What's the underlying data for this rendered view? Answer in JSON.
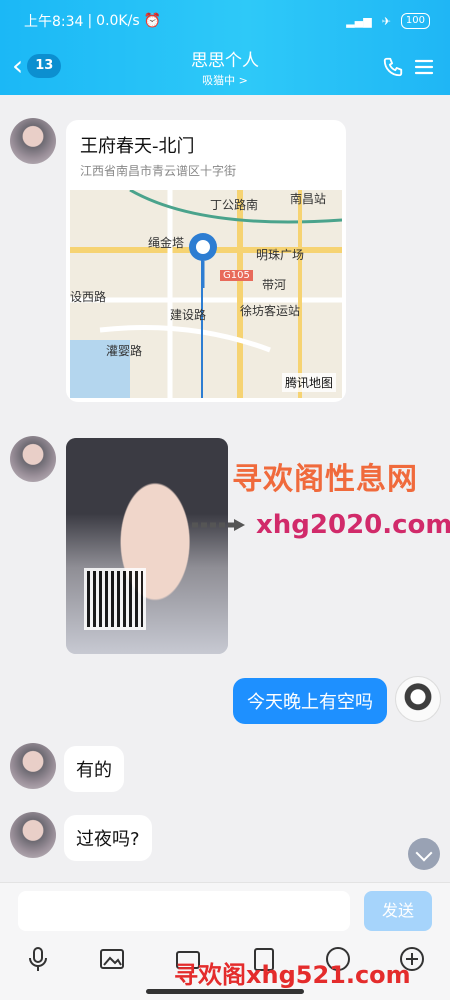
{
  "status_bar": {
    "time": "上午8:34",
    "network_speed": "0.0K/s",
    "battery": "100"
  },
  "header": {
    "unread_count": "13",
    "title": "思思个人",
    "subtitle": "吸猫中 >"
  },
  "messages": {
    "location": {
      "title": "王府春天-北门",
      "address": "江西省南昌市青云谱区十字街",
      "map_brand": "腾讯地图",
      "map_labels": [
        "丁公路南",
        "南昌站",
        "绳金塔",
        "明珠广场",
        "G105",
        "带河",
        "设西路",
        "建设路",
        "徐坊客运站",
        "灌婴路"
      ]
    },
    "sent_text": "今天晚上有空吗",
    "reply1": "有的",
    "reply2": "过夜吗?"
  },
  "watermark": {
    "line1": "寻欢阁性息网",
    "line2": "xhg2020.com",
    "bottom": "寻欢阁xhg521.com"
  },
  "input": {
    "send_label": "发送",
    "placeholder": ""
  }
}
